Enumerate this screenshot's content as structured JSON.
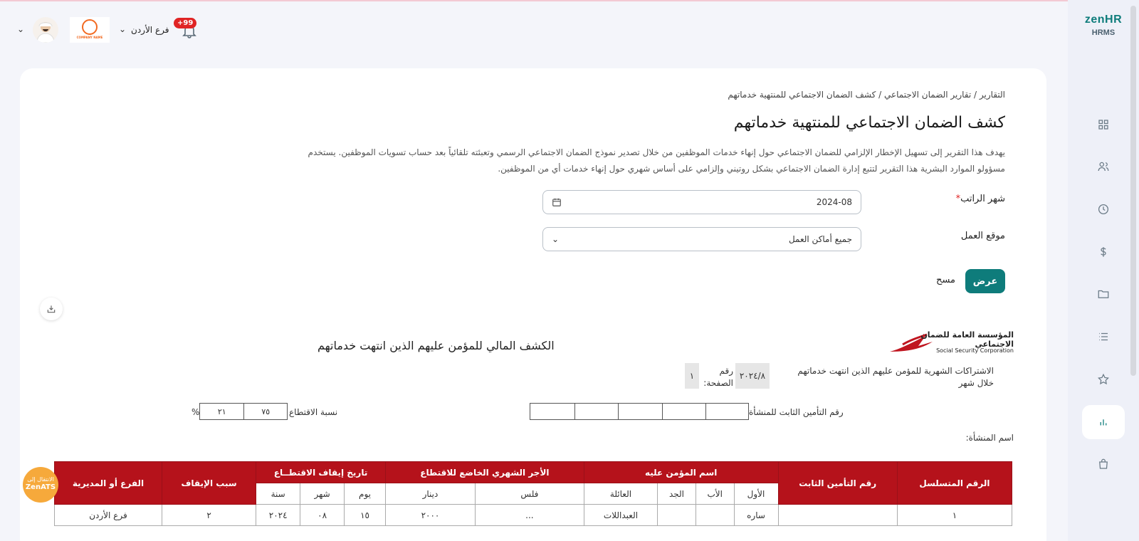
{
  "app": {
    "logo_main": "zen",
    "logo_accent": "HR",
    "logo_sub": "HRMS"
  },
  "header": {
    "branch": "فرع الأردن",
    "notif_badge": "+99",
    "company_logo_text": "COMPANY NAME"
  },
  "sidebar": {
    "items": [
      "dashboard-icon",
      "users-icon",
      "clock-icon",
      "dollar-icon",
      "folder-icon",
      "list-icon",
      "star-icon",
      "chart-icon",
      "bag-icon"
    ],
    "active": "chart-icon"
  },
  "breadcrumb": "التقارير / تقارير الضمان الاجتماعي / كشف الضمان الاجتماعي للمنتهية خدماتهم",
  "page": {
    "title": "كشف الضمان الاجتماعي للمنتهية خدماتهم",
    "description": "يهدف هذا التقرير إلى تسهيل الإخطار الإلزامي للضمان الاجتماعي حول إنهاء خدمات الموظفين من خلال تصدير نموذج الضمان الاجتماعي الرسمي وتعبئته تلقائياً بعد حساب تسويات الموظفين. يستخدم مسؤولو الموارد البشرية هذا التقرير لتتبع إدارة الضمان الاجتماعي بشكل روتيني وإلزامي على أساس شهري حول إنهاء خدمات أي من الموظفين."
  },
  "form": {
    "salary_month_label": "شهر الراتب",
    "salary_month_required": "*",
    "salary_month_value": "2024-08",
    "location_label": "موقع العمل",
    "location_value": "جميع أماكن العمل",
    "show_button": "عرض",
    "clear_button": "مسح"
  },
  "report": {
    "ssc_logo_text": "المؤسسة العامة للضمان الاجتماعي",
    "ssc_logo_en": "Social Security Corporation",
    "title": "الكشف المالي للمؤمن عليهم الذين انتهت خدماتهم",
    "monthly_label": "الاشتراكات الشهرية للمؤمن عليهم الذين انتهت خدماتهم خلال شهر",
    "month_value": "٢٠٢٤/٨",
    "page_label": "رقم الصفحة:",
    "page_value": "١",
    "fixed_insurance_label": "رقم التأمين الثابت للمنشأة",
    "deduction_ratio_label": "نسبة الاقتطاع",
    "deduction_cells": [
      "٧٥",
      "٢١"
    ],
    "percent": "%",
    "establishment_label": "اسم المنشأة:"
  },
  "table": {
    "h_serial": "الرقم المتسلسل",
    "h_fixed_insurance": "رقم التأمين الثابت",
    "h_insured_name": "اسم المؤمن عليه",
    "h_wage": "الأجر الشهري الخاضع للاقتطاع",
    "h_stop_date": "تاريخ إيقاف الاقتطــاع",
    "h_reason": "سبب الإيقاف",
    "h_branch": "الفرع أو المديرية",
    "sub_first": "الأول",
    "sub_father": "الأب",
    "sub_grand": "الجد",
    "sub_family": "العائلة",
    "sub_fils": "فلس",
    "sub_dinar": "دينار",
    "sub_day": "يوم",
    "sub_month": "شهر",
    "sub_year": "سنة",
    "rows": [
      {
        "serial": "١",
        "fixed": "",
        "first": "ساره",
        "father": "",
        "grand": "",
        "family": "العبداللات",
        "fils": "...",
        "dinar": "٢٠٠٠",
        "day": "١٥",
        "month": "٠٨",
        "year": "٢٠٢٤",
        "reason": "٢",
        "branch": "فرع الأردن"
      }
    ]
  },
  "zenats": {
    "line1": "الانتقال إلى",
    "line2": "ZenATS"
  }
}
